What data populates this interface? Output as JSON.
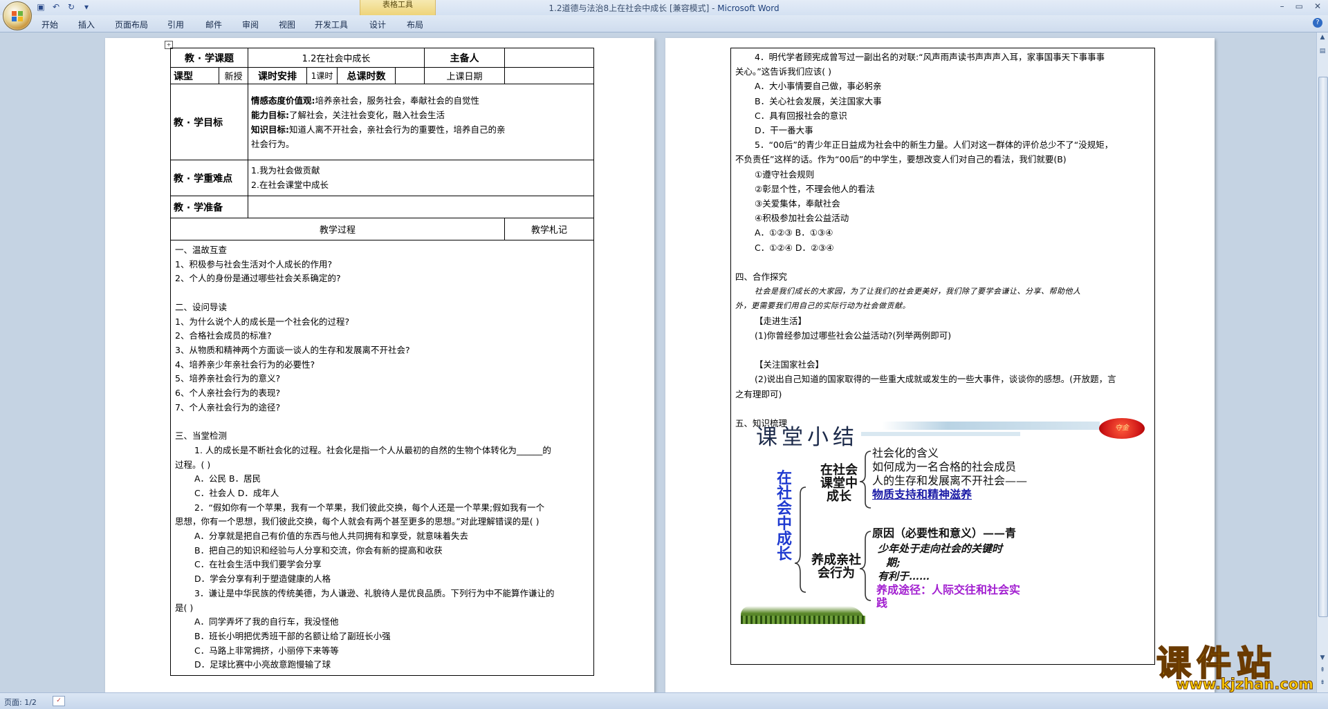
{
  "window": {
    "title": "1.2道德与法治8上在社会中成长 [兼容模式]",
    "app_name": "Microsoft Word",
    "context_tool": "表格工具",
    "controls": [
      "–",
      "▭",
      "✕"
    ]
  },
  "ribbon": {
    "tabs": [
      "开始",
      "插入",
      "页面布局",
      "引用",
      "邮件",
      "审阅",
      "视图",
      "开发工具",
      "设计",
      "布局"
    ]
  },
  "status": {
    "page": "页面: 1/2"
  },
  "lesson_plan": {
    "title_label": "教 · 学课题",
    "title_value": "1.2在社会中成长",
    "preparer_label": "主备人",
    "type_label": "课型",
    "type_value": "新授",
    "schedule_label": "课时安排",
    "schedule_value": "1课时",
    "total_label": "总课时数",
    "date_label": "上课日期",
    "goals_label": "教 · 学目标",
    "goal1_bold": "情感态度价值观:",
    "goal1_text": "培养亲社会，服务社会，奉献社会的自觉性",
    "goal2_bold": "能力目标:",
    "goal2_text": "了解社会，关注社会变化，融入社会生活",
    "goal3_bold": "知识目标:",
    "goal3_text": "知道人离不开社会，亲社会行为的重要性，培养自己的亲",
    "goal3_text2": "社会行为。",
    "key_label": "教 · 学重难点",
    "key1": "1.我为社会做贡献",
    "key2": "2.在社会课堂中成长",
    "prep_label": "教 · 学准备",
    "process_label": "教学过程",
    "notes_label": "教学札记",
    "body": [
      "一、温故互查",
      "1、积极参与社会生活对个人成长的作用?",
      "2、个人的身份是通过哪些社会关系确定的?",
      "",
      "二、设问导读",
      "1、为什么说个人的成长是一个社会化的过程?",
      "2、合格社会成员的标准?",
      "3、从物质和精神两个方面谈一谈人的生存和发展离不开社会?",
      "4、培养亲少年亲社会行为的必要性?",
      "5、培养亲社会行为的意义?",
      "6、个人亲社会行为的表现?",
      "7、个人亲社会行为的途径?",
      "",
      "三、当堂检测",
      "1. 人的成长是不断社会化的过程。社会化是指一个人从最初的自然的生物个体转化为______的",
      "过程。(    )",
      "A．公民   B．居民",
      "C．社会人   D．成年人",
      "2．“假如你有一个苹果，我有一个苹果，我们彼此交换，每个人还是一个苹果;假如我有一个",
      "思想，你有一个思想，我们彼此交换，每个人就会有两个甚至更多的思想。”对此理解错误的是(      )",
      "A．分享就是把自己有价值的东西与他人共同拥有和享受，就意味着失去",
      "B．把自己的知识和经验与人分享和交流，你会有新的提高和收获",
      "C．在社会生活中我们要学会分享",
      "D．学会分享有利于塑造健康的人格",
      "3．谦让是中华民族的传统美德，为人谦逊、礼貌待人是优良品质。下列行为中不能算作谦让的",
      "是(      )",
      "A．同学弄坏了我的自行车，我没怪他",
      "B．班长小明把优秀班干部的名额让给了副班长小强",
      "C．马路上非常拥挤，小丽停下来等等",
      "D．足球比赛中小亮故意跑慢输了球"
    ]
  },
  "right_page": {
    "lines": [
      "4．明代学者顾宪成曾写过一副出名的对联:“风声雨声读书声声声入耳，家事国事天下事事事",
      "关心。”这告诉我们应该(      )",
      "A．大小事情要自己做，事必躬亲",
      "B．关心社会发展，关注国家大事",
      "C．具有回报社会的意识",
      "D．干一番大事",
      "5．“00后”的青少年正日益成为社会中的新生力量。人们对这一群体的评价总少不了“没规矩，",
      "不负责任”这样的话。作为“00后”的中学生，要想改变人们对自己的看法，我们就要(B)",
      "①遵守社会规则",
      "②彰显个性，不理会他人的看法",
      "③关爱集体，奉献社会",
      "④积极参加社会公益活动",
      "A．①②③   B．①③④",
      "C．①②④   D．②③④",
      "",
      "四、合作探究",
      "社会是我们成长的大家园，为了让我们的社会更美好，我们除了要学会谦让、分享、帮助他人",
      "外，更需要我们用自己的实际行动为社会做贡献。",
      "【走进生活】",
      "(1)你曾经参加过哪些社会公益活动?(列举两例即可)",
      "",
      "【关注国家社会】",
      "(2)说出自己知道的国家取得的一些重大成就或发生的一些大事件，谈谈你的感想。(开放题，言",
      "之有理即可)",
      "",
      "五、知识梳理"
    ]
  },
  "summary": {
    "title": "课堂小结",
    "seal_text": "夺金",
    "root": "在社会中成长",
    "branch1": "在社会课堂中成长",
    "branch1_items": [
      "社会化的含义",
      "如何成为一名合格的社会成员",
      "人的生存和发展离不开社会——",
      "物质支持和精神滋养"
    ],
    "branch2": "养成亲社会行为",
    "branch2_items": [
      "原因（必要性和意义）——青",
      "少年处于走向社会的关键时",
      "期;",
      "有利于……",
      "养成途径：人际交往和社会实",
      "践"
    ]
  },
  "watermark": {
    "main": "课件站",
    "url": "www.kjzhan.com"
  }
}
